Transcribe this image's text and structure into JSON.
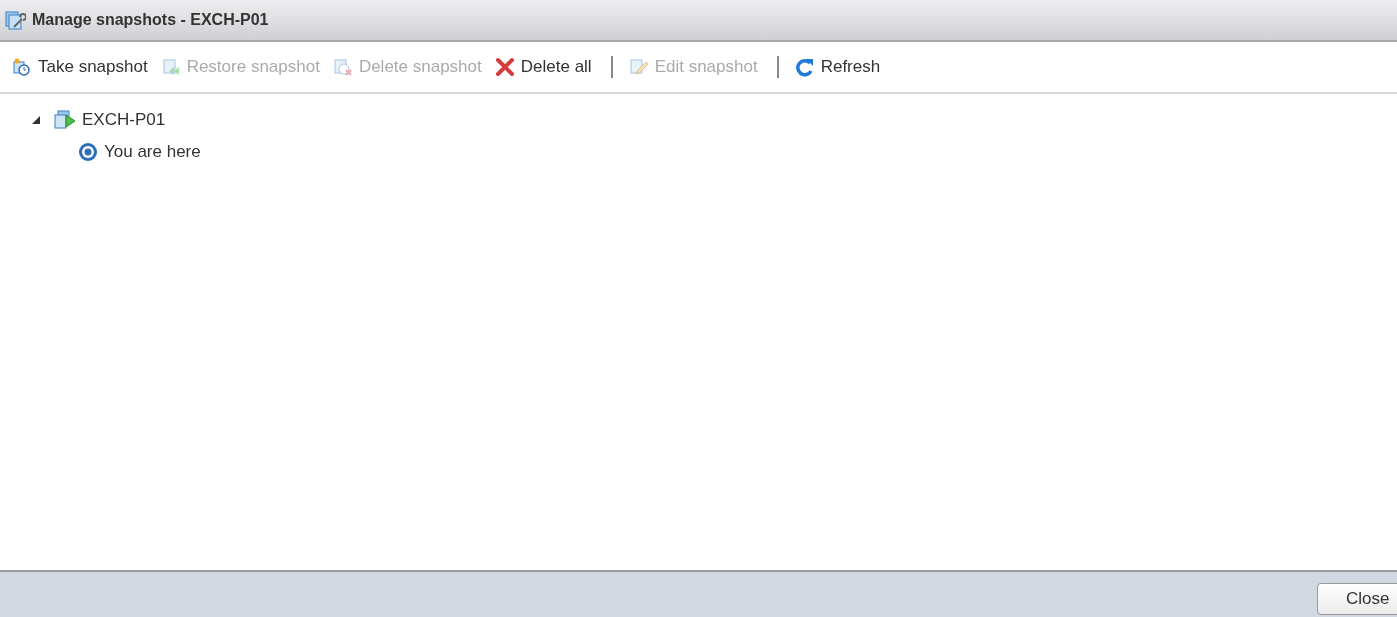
{
  "window": {
    "title": "Manage snapshots - EXCH-P01"
  },
  "toolbar": [
    {
      "label": "Take snapshot",
      "kind": "take",
      "disabled": false,
      "separator_after": false
    },
    {
      "label": "Restore snapshot",
      "kind": "restore",
      "disabled": true,
      "separator_after": false
    },
    {
      "label": "Delete snapshot",
      "kind": "delete",
      "disabled": true,
      "separator_after": false
    },
    {
      "label": "Delete all",
      "kind": "delete-all",
      "disabled": false,
      "separator_after": true
    },
    {
      "label": "Edit snapshot",
      "kind": "edit",
      "disabled": true,
      "separator_after": true
    },
    {
      "label": "Refresh",
      "kind": "refresh",
      "disabled": false,
      "separator_after": false
    }
  ],
  "tree": [
    {
      "label": "EXCH-P01",
      "kind": "vm",
      "expanded": true,
      "children": [
        {
          "label": "You are here",
          "kind": "current"
        }
      ]
    }
  ],
  "footer": {
    "button": "Close"
  }
}
